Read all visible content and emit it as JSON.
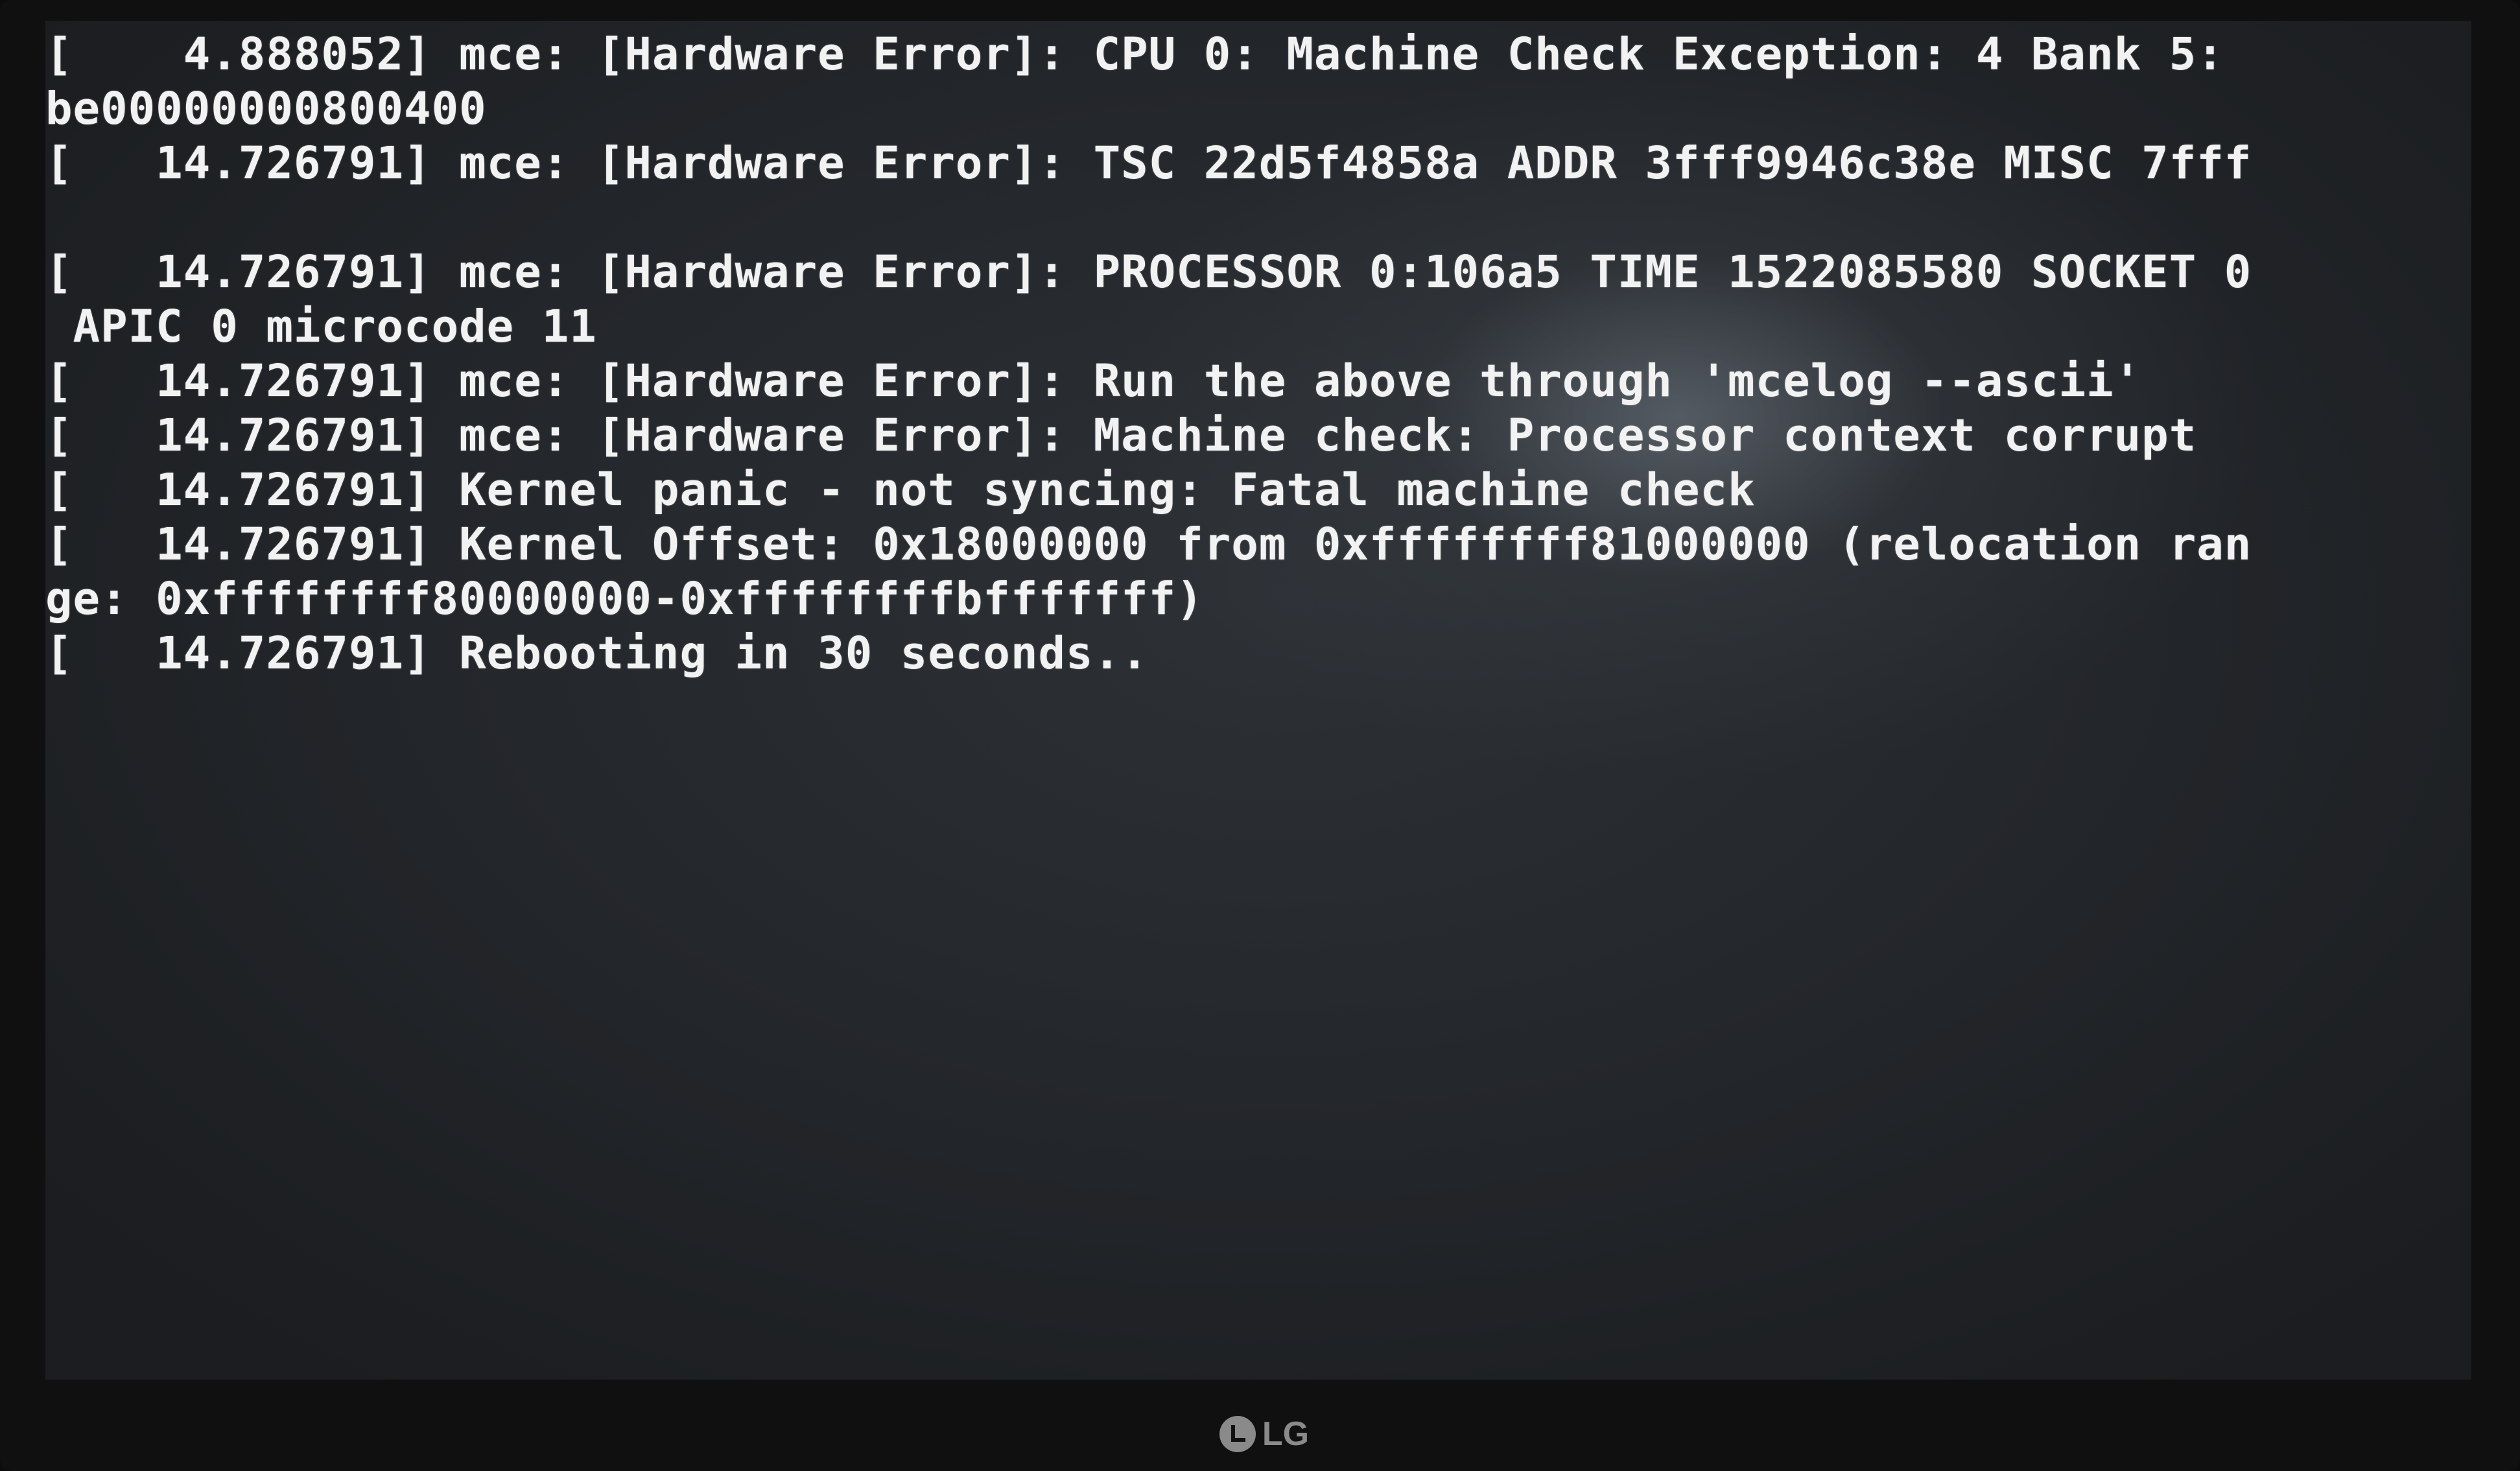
{
  "console": {
    "lines": [
      "[    4.888052] mce: [Hardware Error]: CPU 0: Machine Check Exception: 4 Bank 5:",
      "be00000000800400",
      "[   14.726791] mce: [Hardware Error]: TSC 22d5f4858a ADDR 3fff9946c38e MISC 7fff",
      "",
      "[   14.726791] mce: [Hardware Error]: PROCESSOR 0:106a5 TIME 1522085580 SOCKET 0",
      " APIC 0 microcode 11",
      "[   14.726791] mce: [Hardware Error]: Run the above through 'mcelog --ascii'",
      "[   14.726791] mce: [Hardware Error]: Machine check: Processor context corrupt",
      "[   14.726791] Kernel panic - not syncing: Fatal machine check",
      "[   14.726791] Kernel Offset: 0x18000000 from 0xffffffff81000000 (relocation ran",
      "ge: 0xffffffff80000000-0xffffffffbfffffff)",
      "[   14.726791] Rebooting in 30 seconds.."
    ]
  },
  "monitor": {
    "brand": "LG"
  },
  "colors": {
    "text": "#f2f2f2",
    "screen_bg": "#23262a",
    "bezel": "#101010"
  }
}
